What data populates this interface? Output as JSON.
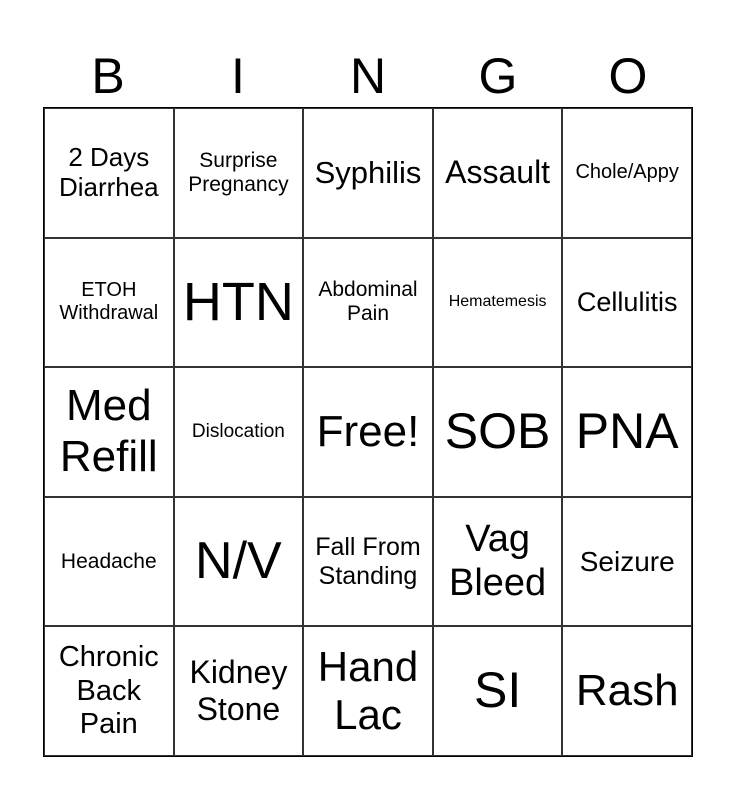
{
  "header": [
    "B",
    "I",
    "N",
    "G",
    "O"
  ],
  "cells": [
    {
      "text": "2 Days Diarrhea",
      "size": 26
    },
    {
      "text": "Surprise Pregnancy",
      "size": 21
    },
    {
      "text": "Syphilis",
      "size": 31
    },
    {
      "text": "Assault",
      "size": 32
    },
    {
      "text": "Chole/Appy",
      "size": 20
    },
    {
      "text": "ETOH Withdrawal",
      "size": 20
    },
    {
      "text": "HTN",
      "size": 54
    },
    {
      "text": "Abdominal Pain",
      "size": 21
    },
    {
      "text": "Hematemesis",
      "size": 16
    },
    {
      "text": "Cellulitis",
      "size": 27
    },
    {
      "text": "Med Refill",
      "size": 44
    },
    {
      "text": "Dislocation",
      "size": 19
    },
    {
      "text": "Free!",
      "size": 44
    },
    {
      "text": "SOB",
      "size": 50
    },
    {
      "text": "PNA",
      "size": 50
    },
    {
      "text": "Headache",
      "size": 21
    },
    {
      "text": "N/V",
      "size": 52
    },
    {
      "text": "Fall From Standing",
      "size": 25
    },
    {
      "text": "Vag Bleed",
      "size": 38
    },
    {
      "text": "Seizure",
      "size": 28
    },
    {
      "text": "Chronic Back Pain",
      "size": 29
    },
    {
      "text": "Kidney Stone",
      "size": 32
    },
    {
      "text": "Hand Lac",
      "size": 42
    },
    {
      "text": "SI",
      "size": 50
    },
    {
      "text": "Rash",
      "size": 44
    }
  ]
}
